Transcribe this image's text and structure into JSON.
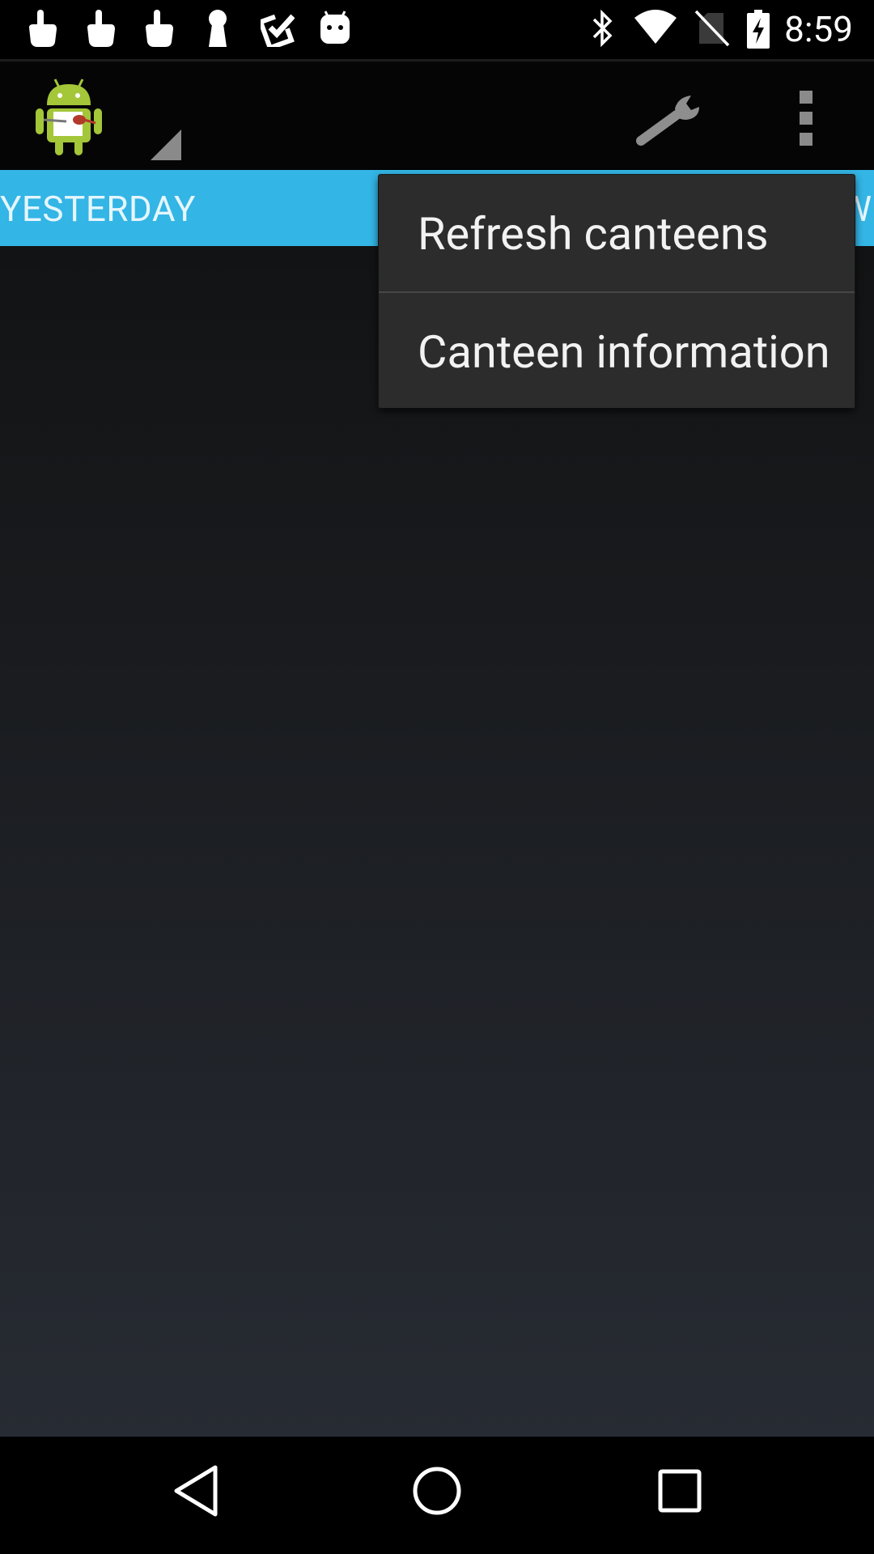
{
  "status_bar": {
    "time": "8:59",
    "left_icons": [
      "touch-icon",
      "touch-icon",
      "touch-icon",
      "keyhole-icon",
      "checkbox-icon",
      "android-face-icon"
    ],
    "right_icons": [
      "bluetooth-icon",
      "wifi-icon",
      "no-sim-icon",
      "battery-charging-icon"
    ]
  },
  "action_bar": {
    "icons": [
      "app-logo-icon",
      "spinner-triangle-icon",
      "wrench-icon",
      "overflow-menu-icon"
    ]
  },
  "tabs": {
    "left_label": "YESTERDAY",
    "right_partial": "W"
  },
  "popup_menu": {
    "items": [
      {
        "label": "Refresh canteens"
      },
      {
        "label": "Canteen information"
      }
    ]
  },
  "navigation": {
    "icons": [
      "back-icon",
      "home-icon",
      "recents-icon"
    ]
  },
  "colors": {
    "tab_strip": "#33b5e5",
    "menu_bg": "#2c2c2c",
    "android_green": "#a4c639"
  }
}
